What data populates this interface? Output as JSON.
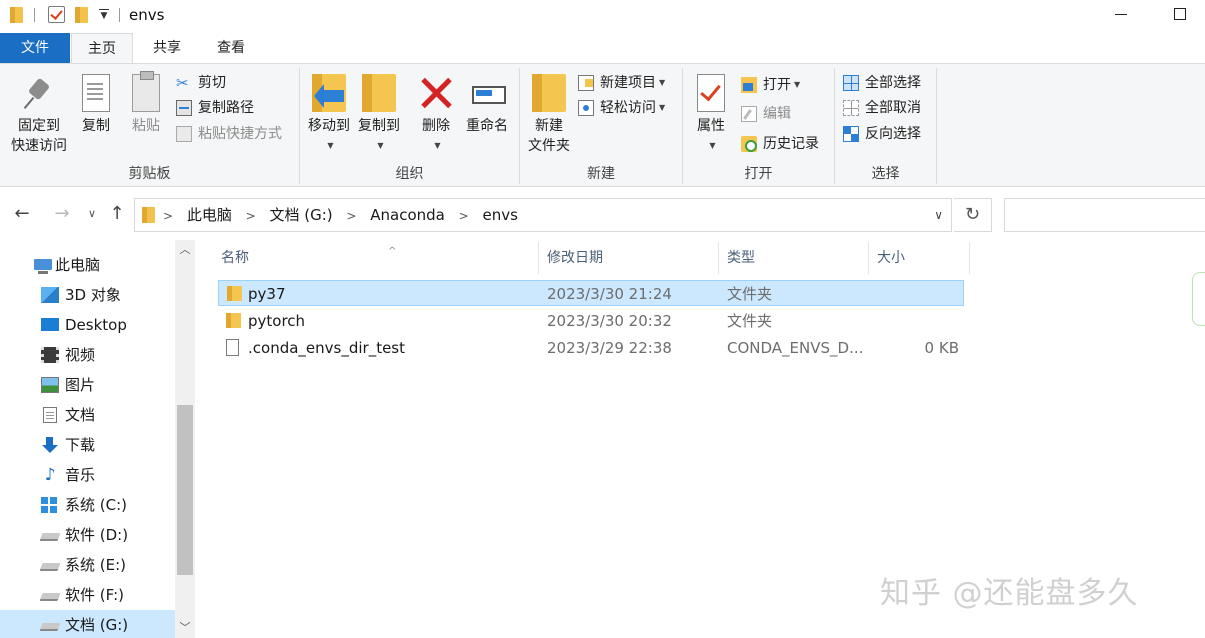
{
  "window": {
    "title": "envs"
  },
  "ribbon_tabs": [
    {
      "label": "文件"
    },
    {
      "label": "主页"
    },
    {
      "label": "共享"
    },
    {
      "label": "查看"
    }
  ],
  "ribbon": {
    "clipboard": {
      "label": "剪贴板",
      "pin_line1": "固定到",
      "pin_line2": "快速访问",
      "copy": "复制",
      "paste": "粘贴",
      "cut": "剪切",
      "copy_path": "复制路径",
      "paste_shortcut": "粘贴快捷方式"
    },
    "organize": {
      "label": "组织",
      "move_to": "移动到",
      "copy_to": "复制到",
      "delete": "删除",
      "rename": "重命名"
    },
    "new": {
      "label": "新建",
      "new_folder_line1": "新建",
      "new_folder_line2": "文件夹",
      "new_item": "新建项目",
      "easy_access": "轻松访问"
    },
    "open": {
      "label": "打开",
      "properties": "属性",
      "open": "打开",
      "edit": "编辑",
      "history": "历史记录"
    },
    "select": {
      "label": "选择",
      "select_all": "全部选择",
      "select_none": "全部取消",
      "invert": "反向选择"
    }
  },
  "address": {
    "crumbs": [
      "此电脑",
      "文档 (G:)",
      "Anaconda",
      "envs"
    ]
  },
  "nav_pane": [
    {
      "label": "此电脑",
      "icon": "computer-icon"
    },
    {
      "label": "3D 对象",
      "icon": "3d-objects-icon"
    },
    {
      "label": "Desktop",
      "icon": "desktop-icon"
    },
    {
      "label": "视频",
      "icon": "video-icon"
    },
    {
      "label": "图片",
      "icon": "pictures-icon"
    },
    {
      "label": "文档",
      "icon": "documents-icon"
    },
    {
      "label": "下载",
      "icon": "downloads-icon"
    },
    {
      "label": "音乐",
      "icon": "music-icon"
    },
    {
      "label": "系统 (C:)",
      "icon": "windows-drive-icon"
    },
    {
      "label": "软件 (D:)",
      "icon": "drive-icon"
    },
    {
      "label": "系统 (E:)",
      "icon": "drive-icon"
    },
    {
      "label": "软件 (F:)",
      "icon": "drive-icon"
    },
    {
      "label": "文档 (G:)",
      "icon": "drive-icon"
    }
  ],
  "columns": {
    "name": "名称",
    "date": "修改日期",
    "type": "类型",
    "size": "大小"
  },
  "files": [
    {
      "name": "py37",
      "date": "2023/3/30 21:24",
      "type": "文件夹",
      "size": "",
      "kind": "folder",
      "selected": true
    },
    {
      "name": "pytorch",
      "date": "2023/3/30 20:32",
      "type": "文件夹",
      "size": "",
      "kind": "folder",
      "selected": false
    },
    {
      "name": ".conda_envs_dir_test",
      "date": "2023/3/29 22:38",
      "type": "CONDA_ENVS_D...",
      "size": "0 KB",
      "kind": "file",
      "selected": false
    }
  ],
  "watermark": "知乎 @还能盘多久"
}
